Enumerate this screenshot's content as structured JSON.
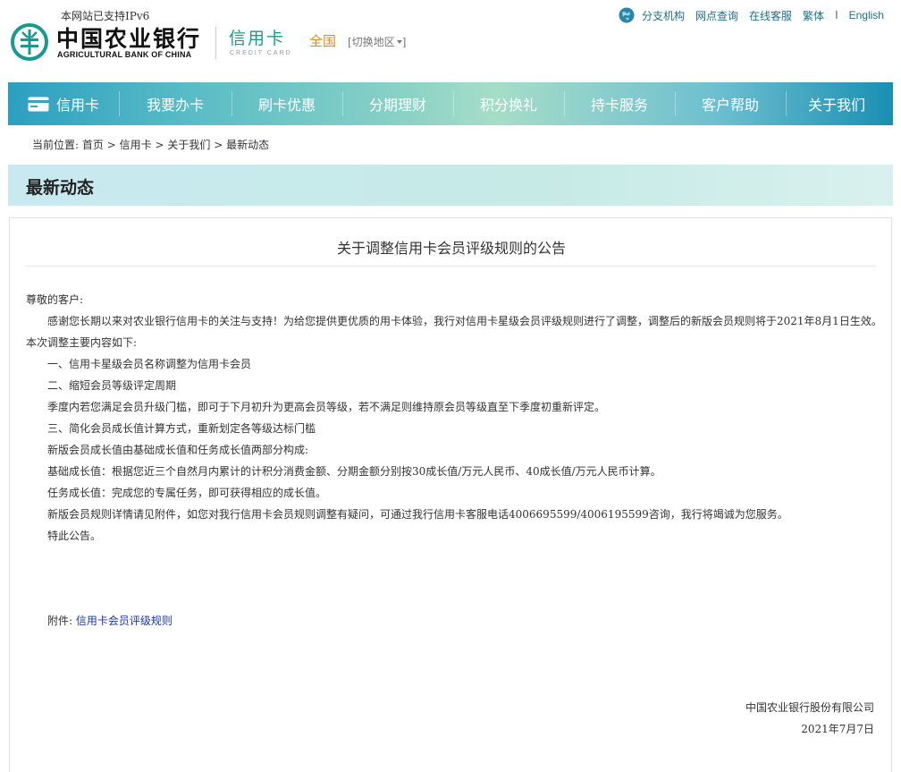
{
  "header": {
    "ipv6_notice": "本网站已支持IPv6",
    "logo_cn": "中国农业银行",
    "logo_en": "AGRICULTURAL BANK OF CHINA",
    "section_cn": "信用卡",
    "section_en": "CREDIT CARD",
    "region": "全国",
    "switch_region": "[切换地区",
    "switch_region_close": "]",
    "top_links": [
      "分支机构",
      "网点查询",
      "在线客服",
      "繁体",
      "English"
    ],
    "top_sep": "I",
    "colors": {
      "brand_green": "#1a9a8f",
      "region_orange": "#e08a1e",
      "link_blue": "#1f6f8b"
    }
  },
  "nav": {
    "items": [
      "信用卡",
      "我要办卡",
      "刷卡优惠",
      "分期理财",
      "积分换礼",
      "持卡服务",
      "客户帮助",
      "关于我们"
    ]
  },
  "breadcrumb": {
    "prefix": "当前位置:",
    "items": [
      "首页",
      "信用卡",
      "关于我们",
      "最新动态"
    ],
    "sep": ">"
  },
  "section": {
    "title": "最新动态"
  },
  "notice": {
    "title": "关于调整信用卡会员评级规则的公告",
    "lines": [
      "尊敬的客户:",
      "感谢您长期以来对农业银行信用卡的关注与支持！为给您提供更优质的用卡体验，我行对信用卡星级会员评级规则进行了调整，调整后的新版会员规则将于2021年8月1日生效。",
      "本次调整主要内容如下:",
      "一、信用卡星级会员名称调整为信用卡会员",
      "二、缩短会员等级评定周期",
      "季度内若您满足会员升级门槛，即可于下月初升为更高会员等级，若不满足则维持原会员等级直至下季度初重新评定。",
      "三、简化会员成长值计算方式，重新划定各等级达标门槛",
      "新版会员成长值由基础成长值和任务成长值两部分构成:",
      "基础成长值：根据您近三个自然月内累计的计积分消费金额、分期金额分别按30成长值/万元人民币、40成长值/万元人民币计算。",
      "任务成长值：完成您的专属任务，即可获得相应的成长值。",
      "新版会员规则详情请见附件，如您对我行信用卡会员规则调整有疑问，可通过我行信用卡客服电话4006695599/4006195599咨询，我行将竭诚为您服务。",
      "特此公告。"
    ],
    "attachment_label": "附件:",
    "attachment_link": "信用卡会员评级规则",
    "signature_org": "中国农业银行股份有限公司",
    "signature_date": "2021年7月7日"
  }
}
